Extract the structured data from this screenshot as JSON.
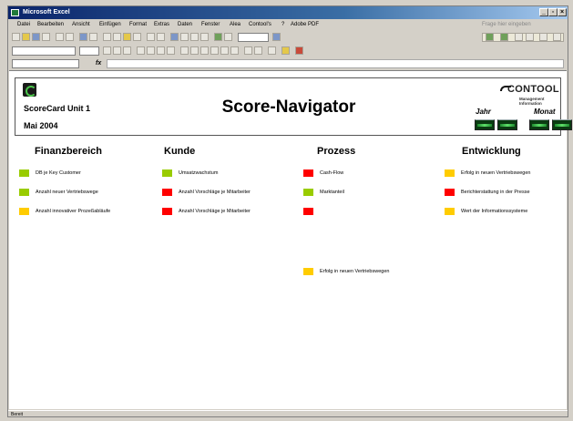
{
  "window": {
    "title": "Microsoft Excel"
  },
  "menu": {
    "items": [
      "Datei",
      "Bearbeiten",
      "Ansicht",
      "Einfügen",
      "Format",
      "Extras",
      "Daten",
      "Fenster",
      "Alea",
      "Contool's",
      "?",
      "Adobe PDF"
    ],
    "help_placeholder": "Frage hier eingeben"
  },
  "status": {
    "text": "Bereit"
  },
  "sheet": {
    "unit": "ScoreCard Unit 1",
    "date": "Mai 2004",
    "title": "Score-Navigator",
    "brand": {
      "name": "CONTOOL",
      "tagline": "Management Information"
    },
    "period_labels": {
      "year": "Jahr",
      "month": "Monat"
    },
    "colors": {
      "green": "#99cc00",
      "red": "#ff0000",
      "yellow": "#ffcc00"
    },
    "columns": [
      {
        "title": "Finanzbereich",
        "items": [
          {
            "label": "DB je Key Customer",
            "status": "green"
          },
          {
            "label": "Anzahl neuer Vertriebswege",
            "status": "green"
          },
          {
            "label": "Anzahl innovativer Prozeßabläufe",
            "status": "yellow"
          }
        ]
      },
      {
        "title": "Kunde",
        "items": [
          {
            "label": "Umsatzwachstum",
            "status": "green"
          },
          {
            "label": "Anzahl Vorschläge je Mitarbeiter",
            "status": "red"
          },
          {
            "label": "Anzahl Vorschläge je Mitarbeiter",
            "status": "red"
          }
        ]
      },
      {
        "title": "Prozess",
        "items": [
          {
            "label": "Cash-Flow",
            "status": "red"
          },
          {
            "label": "Marktanteil",
            "status": "green"
          },
          {
            "label": "",
            "status": "red"
          },
          {
            "label": "Erfolg in neuen Vertriebswegen",
            "status": "yellow"
          }
        ]
      },
      {
        "title": "Entwicklung",
        "items": [
          {
            "label": "Erfolg in neuen Vertriebswegen",
            "status": "yellow"
          },
          {
            "label": "Berichterstattung in der Presse",
            "status": "red"
          },
          {
            "label": "Wert der Informationssysteme",
            "status": "yellow"
          }
        ]
      }
    ]
  }
}
